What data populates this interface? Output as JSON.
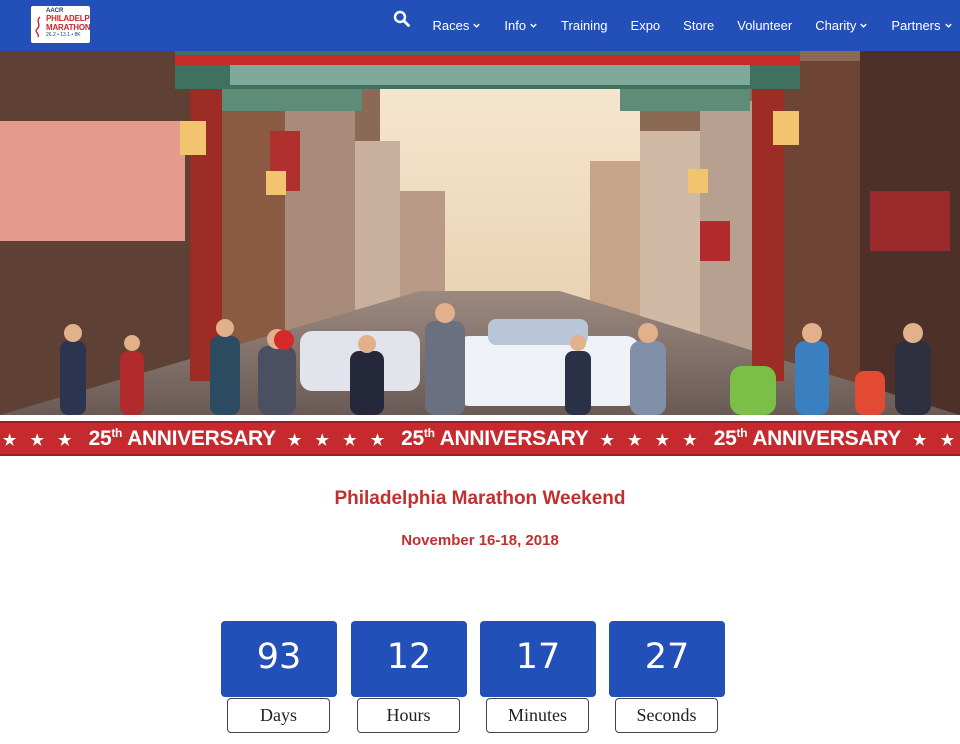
{
  "nav": {
    "logo": {
      "line1": "AACR",
      "line2": "PHILADELPHIA",
      "line3": "MARATHON",
      "line4": "26.2 • 13.1 • 8K"
    },
    "search_icon": "search-icon",
    "items": [
      {
        "label": "Races",
        "has_dropdown": true
      },
      {
        "label": "Info",
        "has_dropdown": true
      },
      {
        "label": "Training",
        "has_dropdown": false
      },
      {
        "label": "Expo",
        "has_dropdown": false
      },
      {
        "label": "Store",
        "has_dropdown": false
      },
      {
        "label": "Volunteer",
        "has_dropdown": false
      },
      {
        "label": "Charity",
        "has_dropdown": true
      },
      {
        "label": "Partners",
        "has_dropdown": true
      }
    ]
  },
  "banner": {
    "text": "ANNIVERSARY",
    "number": "25",
    "suffix": "th",
    "stars": "★ ★ ★ ★"
  },
  "event": {
    "title": "Philadelphia Marathon Weekend",
    "dates": "November 16-18, 2018"
  },
  "countdown": [
    {
      "value": "93",
      "label": "Days"
    },
    {
      "value": "12",
      "label": "Hours"
    },
    {
      "value": "17",
      "label": "Minutes"
    },
    {
      "value": "27",
      "label": "Seconds"
    }
  ],
  "colors": {
    "nav_bg": "#2350b8",
    "accent_red": "#c1302d",
    "banner_red": "#c62a2f",
    "countdown_bg": "#2350b8"
  }
}
